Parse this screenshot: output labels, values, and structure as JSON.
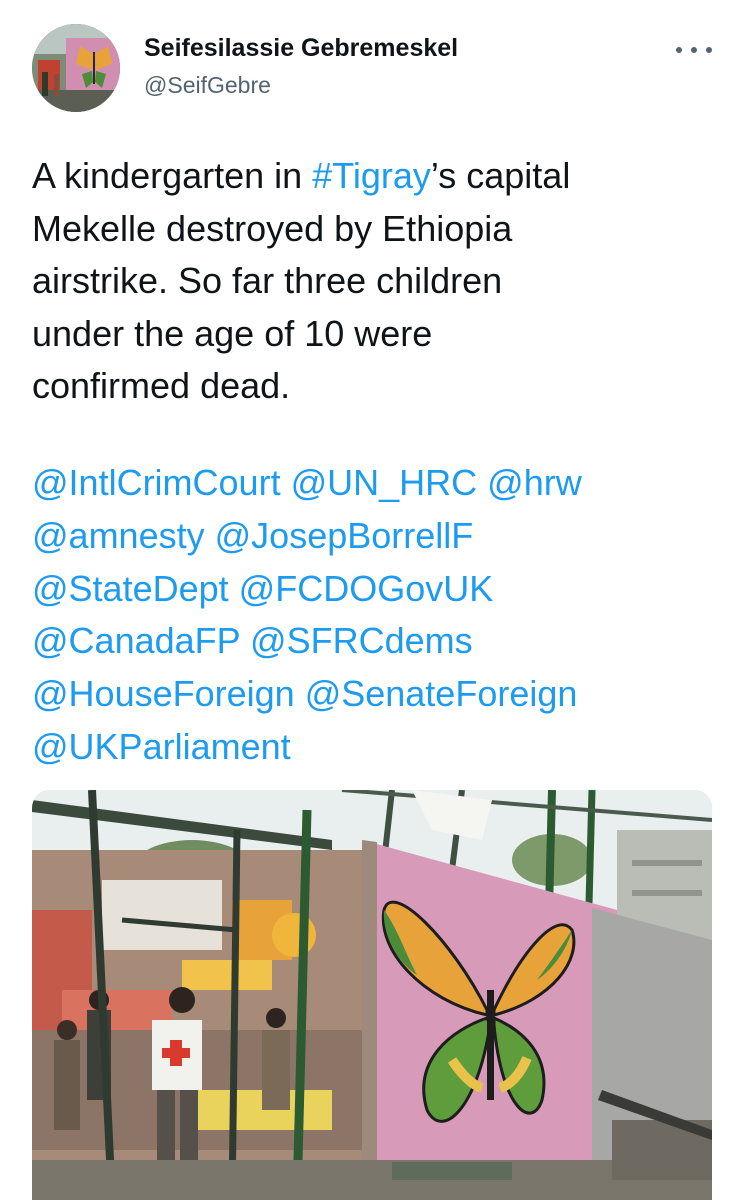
{
  "author": {
    "display_name": "Seifesilassie Gebremeskel",
    "handle": "@SeifGebre",
    "avatar_icon": "profile-photo-butterfly-mural"
  },
  "menu": {
    "icon": "more-horizontal-icon"
  },
  "tweet": {
    "line1_pre": "A kindergarten in ",
    "hashtag": "#Tigray",
    "line1_post": "’s capital",
    "line2": "Mekelle destroyed by Ethiopia",
    "line3": "airstrike. So far three children",
    "line4": "under the age of 10 were",
    "line5": "confirmed dead."
  },
  "mentions": [
    [
      "@IntlCrimCourt",
      "@UN_HRC",
      "@hrw"
    ],
    [
      "@amnesty",
      "@JosepBorrellF"
    ],
    [
      "@StateDept",
      "@FCDOGovUK"
    ],
    [
      "@CanadaFP",
      "@SFRCdems"
    ],
    [
      "@HouseForeign",
      "@SenateForeign"
    ],
    [
      "@UKParliament"
    ]
  ],
  "media": {
    "description_icon": "destroyed-kindergarten-butterfly-mural-photo"
  },
  "colors": {
    "link": "#1d9bf0",
    "text": "#0f1419",
    "secondary": "#536471"
  }
}
